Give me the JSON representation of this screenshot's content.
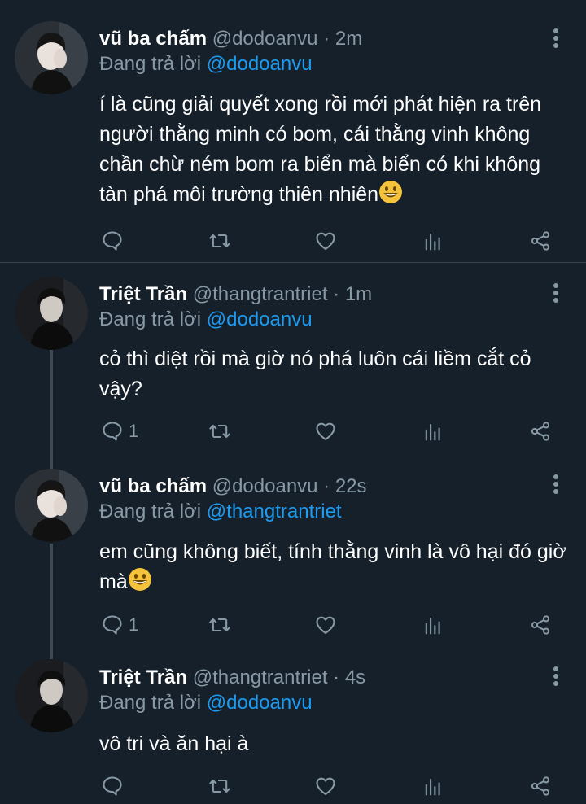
{
  "tweets": [
    {
      "name": "vũ ba chấm",
      "meta": "@dodoanvu · 2m",
      "reply_prefix": "Đang trả lời ",
      "reply_handle": "@dodoanvu",
      "text": "í là cũng giải quyết xong rồi mới phát hiện ra trên người thằng minh có bom, cái thằng vinh không chần chừ ném bom ra biển mà biển có khi không tàn phá môi trường thiên nhiên",
      "reply_count": ""
    },
    {
      "name": "Triệt Trần",
      "meta": "@thangtrantriet · 1m",
      "reply_prefix": "Đang trả lời ",
      "reply_handle": "@dodoanvu",
      "text": "cỏ thì diệt rồi mà giờ nó phá luôn cái liềm cắt cỏ vậy?",
      "reply_count": "1"
    },
    {
      "name": "vũ ba chấm",
      "meta": "@dodoanvu · 22s",
      "reply_prefix": "Đang trả lời ",
      "reply_handle": "@thangtrantriet",
      "text": "em cũng không biết, tính thằng vinh là vô hại đó giờ mà",
      "reply_count": "1"
    },
    {
      "name": "Triệt Trần",
      "meta": "@thangtrantriet · 4s",
      "reply_prefix": "Đang trả lời ",
      "reply_handle": "@dodoanvu",
      "text": "vô tri và ăn hại à",
      "reply_count": ""
    }
  ],
  "icons": {
    "reply": "reply-icon",
    "retweet": "retweet-icon",
    "like": "heart-icon",
    "views": "views-icon",
    "share": "share-icon",
    "more": "more-icon",
    "emoji": "grinning-face-emoji"
  },
  "colors": {
    "background": "#15202b",
    "text": "#ffffff",
    "secondary": "#8899a6",
    "link": "#1d9bf0",
    "divider": "#38444d"
  }
}
